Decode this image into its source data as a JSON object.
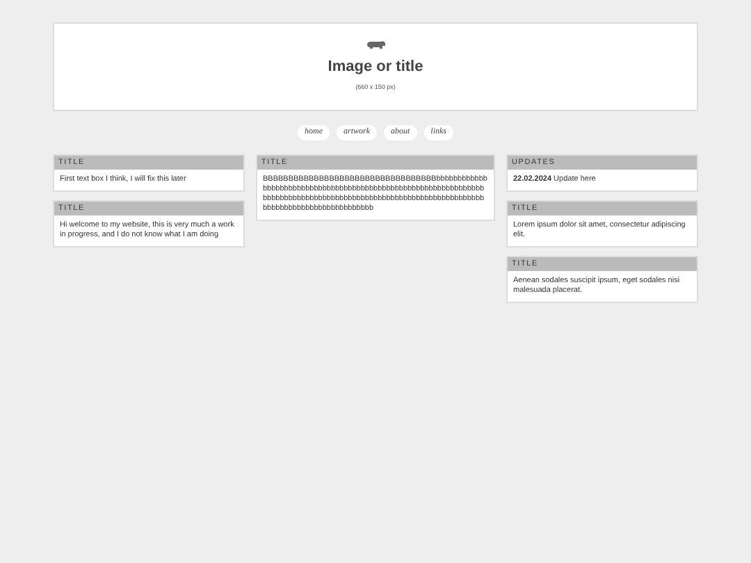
{
  "header": {
    "title": "Image or title",
    "subtitle": "(660 x 150 px)"
  },
  "nav": [
    {
      "label": "home"
    },
    {
      "label": "artwork"
    },
    {
      "label": "about"
    },
    {
      "label": "links"
    }
  ],
  "columns": [
    {
      "boxes": [
        {
          "title": "TITLE",
          "text": "First text box I think, I will fix this later"
        },
        {
          "title": "TITLE",
          "text": "Hi welcome to my website, this is very much a work in progress, and I do not know what I am doing"
        }
      ]
    },
    {
      "boxes": [
        {
          "title": "TITLE",
          "text": "BBBBBBBBBBBBBBBBBBBBBBBBBBBBBBBBBBbbbbbbbbbbbbbbbbbbbbbbbbbbbbbbbbbbbbbbbbbbbbbbbbbbbbbbbbbbbbbbbbbbbbbbbbbbbbbbbbbbbbbbbbbbbbbbbbbbbbbbbbbbbbbbbbbbbbbbbbbbbbbbbbbbbbbbbbbbbbbb"
        }
      ]
    },
    {
      "boxes": [
        {
          "title": "UPDATES",
          "text": "**22.02.2024** Update here"
        },
        {
          "title": "TITLE",
          "text": "Lorem ipsum dolor sit amet, consectetur adipiscing elit."
        },
        {
          "title": "TITLE",
          "text": "Aenean sodales suscipit ipsum, eget sodales nisi malesuada placerat."
        }
      ]
    }
  ]
}
